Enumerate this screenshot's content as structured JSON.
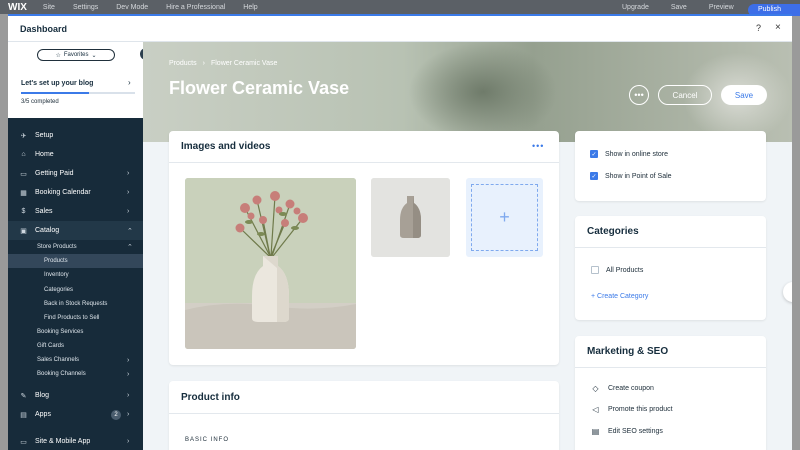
{
  "background_bar": {
    "logo": "WIX",
    "items": [
      "Site",
      "Settings",
      "Dev Mode",
      "Hire a Professional",
      "Help"
    ],
    "right_items": [
      "Upgrade",
      "Save",
      "Preview"
    ],
    "publish": "Publish"
  },
  "modal": {
    "title": "Dashboard",
    "help": "?",
    "close": "×"
  },
  "sidebar": {
    "favorites": "Favorites",
    "setup_title": "Let's set up your blog",
    "setup_progress_text": "3/5 completed",
    "setup_progress": 0.6,
    "items": [
      {
        "icon": "✈",
        "label": "Setup",
        "chevron": ""
      },
      {
        "icon": "⌂",
        "label": "Home",
        "chevron": ""
      },
      {
        "icon": "▭",
        "label": "Getting Paid",
        "chevron": "›"
      },
      {
        "icon": "▦",
        "label": "Booking Calendar",
        "chevron": "›"
      },
      {
        "icon": "$",
        "label": "Sales",
        "chevron": "›"
      },
      {
        "icon": "▣",
        "label": "Catalog",
        "chevron": "⌃"
      }
    ],
    "catalog_sub": [
      {
        "label": "Store Products",
        "chevron": "⌃"
      }
    ],
    "store_products_sub": [
      "Products",
      "Inventory",
      "Categories",
      "Back in Stock Requests",
      "Find Products to Sell"
    ],
    "catalog_sub_more": [
      {
        "label": "Booking Services",
        "chevron": ""
      },
      {
        "label": "Gift Cards",
        "chevron": ""
      },
      {
        "label": "Sales Channels",
        "chevron": "›"
      },
      {
        "label": "Booking Channels",
        "chevron": "›"
      }
    ],
    "bottom_items": [
      {
        "icon": "✎",
        "label": "Blog",
        "chevron": "›",
        "badge": ""
      },
      {
        "icon": "▤",
        "label": "Apps",
        "chevron": "›",
        "badge": "2"
      },
      {
        "icon": "▭",
        "label": "Site & Mobile App",
        "chevron": "›",
        "badge": ""
      }
    ]
  },
  "header": {
    "breadcrumb": [
      "Products",
      "Flower Ceramic Vase"
    ],
    "title": "Flower Ceramic Vase",
    "more": "•••",
    "cancel": "Cancel",
    "save": "Save"
  },
  "media": {
    "title": "Images and videos",
    "more": "•••",
    "add": "+"
  },
  "product_info": {
    "title": "Product info",
    "section": "BASIC INFO"
  },
  "visibility": {
    "items": [
      {
        "label": "Show in online store",
        "checked": true
      },
      {
        "label": "Show in Point of Sale",
        "checked": true
      }
    ]
  },
  "categories": {
    "title": "Categories",
    "items": [
      "All Products"
    ],
    "add": "+ Create Category"
  },
  "marketing": {
    "title": "Marketing & SEO",
    "items": [
      {
        "icon": "◇",
        "label": "Create coupon"
      },
      {
        "icon": "◁",
        "label": "Promote this product"
      },
      {
        "icon": "▤",
        "label": "Edit SEO settings"
      }
    ]
  },
  "colors": {
    "accent": "#3b7ae8",
    "sidebar": "#172b3a"
  }
}
